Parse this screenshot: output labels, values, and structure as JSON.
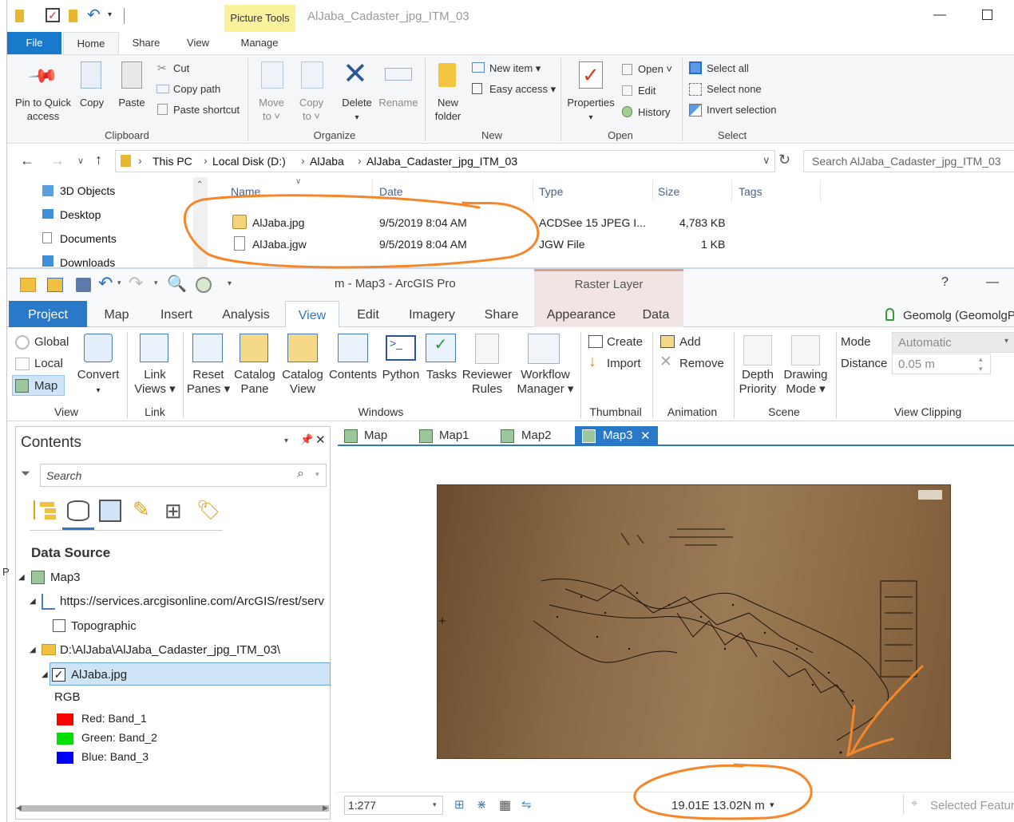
{
  "explorer": {
    "context_tab": "Picture Tools",
    "window_title": "AlJaba_Cadaster_jpg_ITM_03",
    "tabs": [
      "File",
      "Home",
      "Share",
      "View",
      "Manage"
    ],
    "ribbon": {
      "pin_line1": "Pin to Quick",
      "pin_line2": "access",
      "copy": "Copy",
      "paste": "Paste",
      "cut": "Cut",
      "copy_path": "Copy path",
      "paste_shortcut": "Paste shortcut",
      "clipboard_group": "Clipboard",
      "move_to": "Move",
      "move_to2": "to ˅",
      "copy_to": "Copy",
      "copy_to2": "to ˅",
      "delete": "Delete",
      "rename": "Rename",
      "organize_group": "Organize",
      "new_folder1": "New",
      "new_folder2": "folder",
      "new_item": "New item ▾",
      "easy_access": "Easy access ▾",
      "new_group": "New",
      "properties": "Properties",
      "open": "Open ˅",
      "edit": "Edit",
      "history": "History",
      "open_group": "Open",
      "select_all": "Select all",
      "select_none": "Select none",
      "invert_selection": "Invert selection",
      "select_group": "Select"
    },
    "breadcrumb": [
      "This PC",
      "Local Disk (D:)",
      "AlJaba",
      "AlJaba_Cadaster_jpg_ITM_03"
    ],
    "search_placeholder": "Search AlJaba_Cadaster_jpg_ITM_03",
    "nav_items": [
      "3D Objects",
      "Desktop",
      "Documents",
      "Downloads"
    ],
    "columns": [
      "Name",
      "Date",
      "Type",
      "Size",
      "Tags"
    ],
    "files": [
      {
        "name": "AlJaba.jpg",
        "date": "9/5/2019 8:04 AM",
        "type": "ACDSee 15 JPEG I...",
        "size": "4,783 KB"
      },
      {
        "name": "AlJaba.jgw",
        "date": "9/5/2019 8:04 AM",
        "type": "JGW File",
        "size": "1 KB"
      }
    ]
  },
  "arcgis": {
    "title": "m - Map3 - ArcGIS Pro",
    "context_tab": "Raster Layer",
    "help": "?",
    "user": "Geomolg (GeomolgP",
    "tabs": [
      "Project",
      "Map",
      "Insert",
      "Analysis",
      "View",
      "Edit",
      "Imagery",
      "Share",
      "Appearance",
      "Data"
    ],
    "ribbon": {
      "global": "Global",
      "local": "Local",
      "map": "Map",
      "convert": "Convert",
      "view_group": "View",
      "link_views1": "Link",
      "link_views2": "Views ▾",
      "link_group": "Link",
      "reset_panes1": "Reset",
      "reset_panes2": "Panes ▾",
      "catalog_pane1": "Catalog",
      "catalog_pane2": "Pane",
      "catalog_view1": "Catalog",
      "catalog_view2": "View",
      "contents": "Contents",
      "python": "Python",
      "tasks": "Tasks",
      "reviewer1": "Reviewer",
      "reviewer2": "Rules",
      "workflow1": "Workflow",
      "workflow2": "Manager ▾",
      "windows_group": "Windows",
      "create": "Create",
      "import": "Import",
      "thumbnail_group": "Thumbnail",
      "add": "Add",
      "remove": "Remove",
      "animation_group": "Animation",
      "depth1": "Depth",
      "depth2": "Priority",
      "drawing1": "Drawing",
      "drawing2": "Mode ▾",
      "scene_group": "Scene",
      "mode_label": "Mode",
      "mode_value": "Automatic",
      "distance_label": "Distance",
      "distance_value": "0.05  m",
      "clipping_group": "View Clipping"
    },
    "contents": {
      "title": "Contents",
      "search_placeholder": "Search",
      "section": "Data Source",
      "map": "Map3",
      "service": "https://services.arcgisonline.com/ArcGIS/rest/serv",
      "topographic": "Topographic",
      "folder": "D:\\AlJaba\\AlJaba_Cadaster_jpg_ITM_03\\",
      "layer": "AlJaba.jpg",
      "rgb": "RGB",
      "bands": [
        {
          "label": "Red:  Band_1",
          "color": "#ff0000"
        },
        {
          "label": "Green: Band_2",
          "color": "#00e000"
        },
        {
          "label": "Blue:  Band_3",
          "color": "#0000ff"
        }
      ]
    },
    "map_tabs": [
      "Map",
      "Map1",
      "Map2",
      "Map3"
    ],
    "status": {
      "scale": "1:277",
      "coords": "19.01E 13.02N m",
      "selected": "Selected Featur"
    }
  },
  "colors": {
    "accent_blue": "#2a78c8",
    "annotation_orange": "#f5862a",
    "map_brown": "#8c6a45"
  }
}
